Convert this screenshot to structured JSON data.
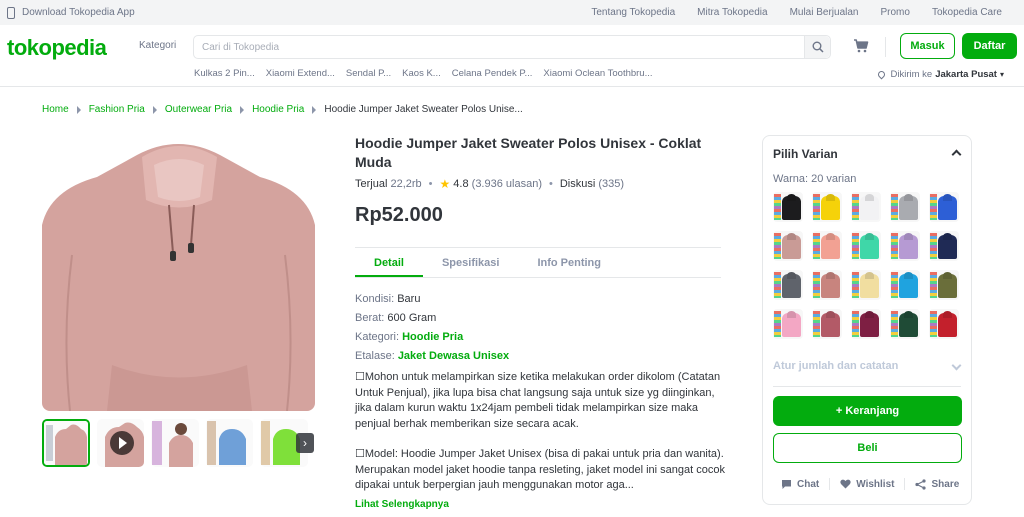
{
  "topbar": {
    "app_link": "Download Tokopedia App",
    "links": [
      "Tentang Tokopedia",
      "Mitra Tokopedia",
      "Mulai Berjualan",
      "Promo",
      "Tokopedia Care"
    ]
  },
  "header": {
    "logo": "tokopedia",
    "kategori": "Kategori",
    "search_placeholder": "Cari di Tokopedia",
    "masuk": "Masuk",
    "daftar": "Daftar",
    "suggestions": [
      "Kulkas 2 Pin...",
      "Xiaomi Extend...",
      "Sendal P...",
      "Kaos K...",
      "Celana Pendek P...",
      "Xiaomi Oclean Toothbru..."
    ],
    "location_prefix": "Dikirim ke",
    "location": "Jakarta Pusat"
  },
  "breadcrumb": [
    "Home",
    "Fashion Pria",
    "Outerwear Pria",
    "Hoodie Pria"
  ],
  "breadcrumb_current": "Hoodie Jumper Jaket Sweater Polos Unise...",
  "product": {
    "title": "Hoodie Jumper Jaket Sweater Polos Unisex - Coklat Muda",
    "terjual_label": "Terjual",
    "terjual_value": "22,2rb",
    "rating": "4.8",
    "ulasan": "(3.936 ulasan)",
    "diskusi_label": "Diskusi",
    "diskusi_value": "(335)",
    "price": "Rp52.000"
  },
  "tabs": [
    "Detail",
    "Spesifikasi",
    "Info Penting"
  ],
  "specs": {
    "kondisi_label": "Kondisi:",
    "kondisi": "Baru",
    "berat_label": "Berat:",
    "berat": "600 Gram",
    "kategori_label": "Kategori:",
    "kategori": "Hoodie Pria",
    "etalase_label": "Etalase:",
    "etalase": "Jaket Dewasa Unisex"
  },
  "description": [
    "☐Mohon untuk melampirkan size ketika melakukan order dikolom (Catatan Untuk Penjual), jika lupa bisa chat langsung saja untuk size yg diinginkan, jika dalam kurun waktu 1x24jam pembeli tidak melampirkan size maka penjual berhak memberikan size secara acak.",
    "☐Model: Hoodie Jumper Jaket Unisex (bisa di pakai untuk pria dan wanita). Merupakan model jaket hoodie tanpa resleting, jaket model ini sangat cocok dipakai untuk berpergian jauh menggunakan motor aga..."
  ],
  "read_more": "Lihat Selengkapnya",
  "variant": {
    "title": "Pilih Varian",
    "warna_label": "Warna:",
    "warna_count": "20 varian",
    "colors": [
      "#1c1c1e",
      "#f5d20a",
      "#f2f2f4",
      "#a9abb0",
      "#2d5fd6",
      "#c99b96",
      "#f2a193",
      "#3fd7a8",
      "#b69ad3",
      "#1f2a55",
      "#5f636b",
      "#c8847e",
      "#f1dea0",
      "#1fa3df",
      "#6a6e3a",
      "#f3a7c4",
      "#b35a67",
      "#7e1f43",
      "#1f4b36",
      "#c3202c"
    ],
    "atur": "Atur jumlah dan catatan",
    "add_cart": "+ Keranjang",
    "beli": "Beli",
    "chat": "Chat",
    "wishlist": "Wishlist",
    "share": "Share"
  }
}
